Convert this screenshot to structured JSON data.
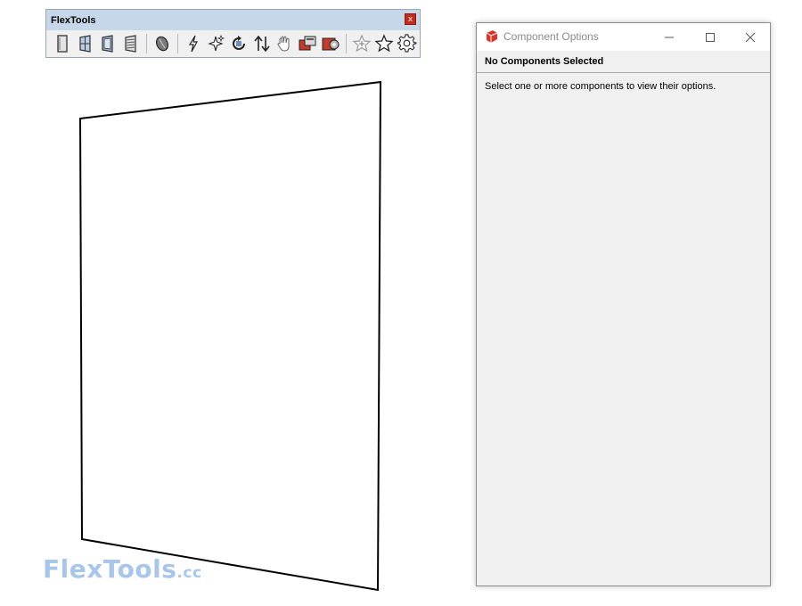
{
  "toolbar": {
    "title": "FlexTools",
    "close_glyph": "x",
    "groups": [
      [
        "door-icon",
        "window-icon",
        "window-frame-icon",
        "louver-icon"
      ],
      [
        "material-icon"
      ],
      [
        "lightning-icon",
        "sparkles-icon",
        "refresh-icon",
        "swap-icon",
        "hand-icon",
        "component-icon",
        "settings-component-icon"
      ],
      [
        "star-add-icon",
        "star-icon",
        "gear-icon"
      ]
    ]
  },
  "window": {
    "title": "Component Options",
    "minimize_glyph": "—",
    "close_glyph": "✕",
    "header": "No Components Selected",
    "body": "Select one or more components to view their options."
  },
  "brand": {
    "main": "FlexTools",
    "suffix": ".cc",
    "color": "#a8c6ea"
  },
  "colors": {
    "titlebar": "#c6d7ea",
    "close_red": "#c42b1c",
    "icon_blue": "#6f8fb5"
  }
}
